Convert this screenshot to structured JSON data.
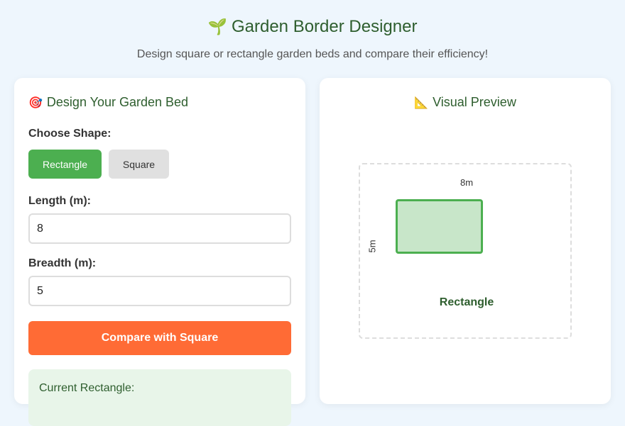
{
  "header": {
    "title": "Garden Border Designer",
    "subtitle": "Design square or rectangle garden beds and compare their efficiency!"
  },
  "icons": {
    "sprout": "sprout-icon",
    "target": "target-icon",
    "ruler": "triangle-ruler-icon"
  },
  "design": {
    "title": "Design Your Garden Bed",
    "shape_label": "Choose Shape:",
    "shape_options": [
      "Rectangle",
      "Square"
    ],
    "selected_shape": "Rectangle",
    "length_label": "Length (m):",
    "length_value": "8",
    "breadth_label": "Breadth (m):",
    "breadth_value": "5",
    "compare_label": "Compare with Square",
    "result_title": "Current Rectangle:"
  },
  "preview": {
    "title": "Visual Preview",
    "width_label": "8m",
    "height_label": "5m",
    "shape_name": "Rectangle"
  },
  "colors": {
    "accent": "#4caf50",
    "compare": "#ff6b35",
    "heading": "#2e5e2e"
  }
}
